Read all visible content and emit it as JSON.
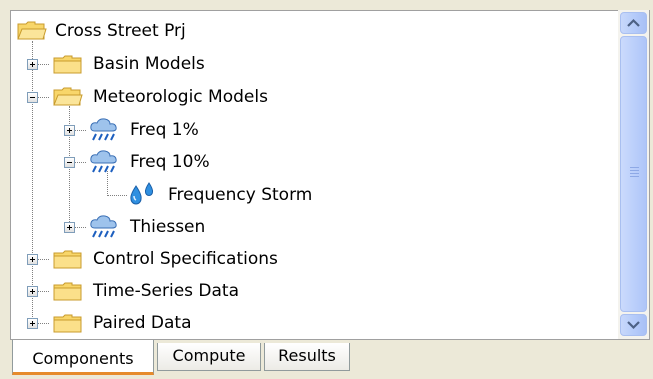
{
  "tree": {
    "root": {
      "label": "Cross Street Prj",
      "icon": "folder-open-icon"
    },
    "items": [
      {
        "label": "Basin Models",
        "icon": "folder-icon",
        "expander": "plus"
      },
      {
        "label": "Meteorologic Models",
        "icon": "folder-open-icon",
        "expander": "minus"
      },
      {
        "label": "Freq 1%",
        "icon": "rain-cloud-icon",
        "expander": "plus"
      },
      {
        "label": "Freq 10%",
        "icon": "rain-cloud-icon",
        "expander": "minus"
      },
      {
        "label": "Frequency Storm",
        "icon": "water-drops-icon",
        "expander": "none"
      },
      {
        "label": "Thiessen",
        "icon": "rain-cloud-icon",
        "expander": "plus"
      },
      {
        "label": "Control Specifications",
        "icon": "folder-icon",
        "expander": "plus"
      },
      {
        "label": "Time-Series Data",
        "icon": "folder-icon",
        "expander": "plus"
      },
      {
        "label": "Paired Data",
        "icon": "folder-icon",
        "expander": "plus"
      }
    ]
  },
  "tabs": [
    {
      "label": "Components",
      "active": true
    },
    {
      "label": "Compute",
      "active": false
    },
    {
      "label": "Results",
      "active": false
    }
  ],
  "colors": {
    "folder": "#F8D66A",
    "folder_outline": "#C89B2C",
    "cloud": "#9EC3EC",
    "rain": "#1D5FBF",
    "drop": "#2F8FE0",
    "tab_active_accent": "#E68B2C",
    "scrollbar": "#B6CCFA"
  }
}
